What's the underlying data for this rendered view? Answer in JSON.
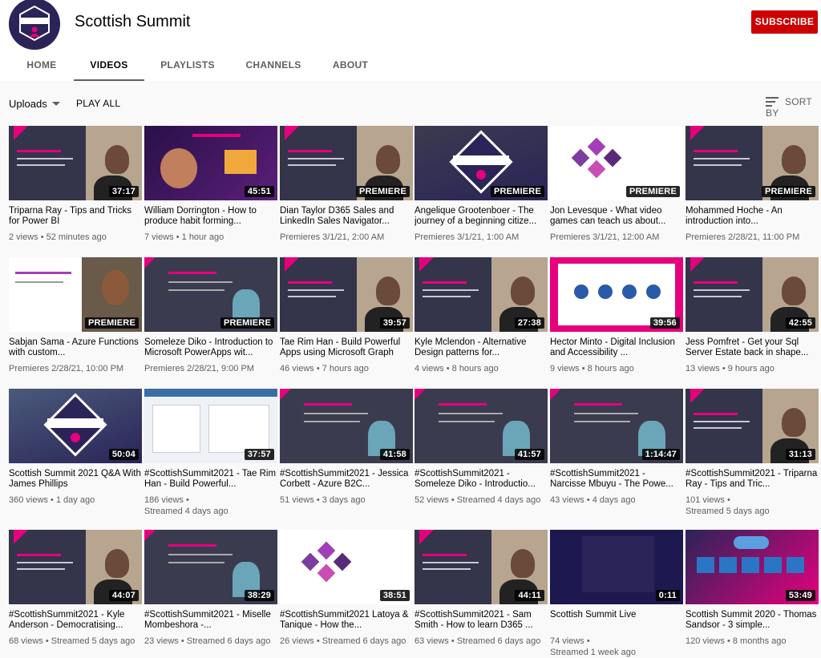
{
  "channel": {
    "name": "Scottish Summit",
    "subscribe_label": "SUBSCRIBE",
    "brand_color": "#2a2458",
    "accent_color": "#e6007e"
  },
  "tabs": [
    "HOME",
    "VIDEOS",
    "PLAYLISTS",
    "CHANNELS",
    "ABOUT"
  ],
  "active_tab": "VIDEOS",
  "toolbar": {
    "uploads_label": "Uploads",
    "play_all_label": "PLAY ALL",
    "sort_by_label": "SORT BY"
  },
  "videos": [
    {
      "title": "Triparna Ray - Tips and Tricks for Power BI",
      "meta1": "2 views • 52 minutes ago",
      "meta2": "",
      "badge": "37:17",
      "theme": "pinkpanel",
      "bg": "#3b3b4f"
    },
    {
      "title": "William Dorrington - How to produce habit forming...",
      "meta1": "7 views • 1 hour ago",
      "meta2": "",
      "badge": "45:51",
      "theme": "purple",
      "bg": "#3a1c5c"
    },
    {
      "title": "Dian Taylor D365 Sales and LinkedIn Sales Navigator...",
      "meta1": "Premieres 3/1/21, 2:00 AM",
      "meta2": "",
      "badge": "PREMIERE",
      "theme": "pinkpanel",
      "bg": "#3b3b4f"
    },
    {
      "title": "Angelique Grootenboer - The journey of a beginning citize...",
      "meta1": "Premieres 3/1/21, 1:00 AM",
      "meta2": "",
      "badge": "PREMIERE",
      "theme": "logo",
      "bg": "#3b3b4f"
    },
    {
      "title": "Jon Levesque - What video games can teach us about...",
      "meta1": "Premieres 3/1/21, 12:00 AM",
      "meta2": "",
      "badge": "PREMIERE",
      "theme": "white",
      "bg": "#ffffff"
    },
    {
      "title": "Mohammed Hoche - An introduction into...",
      "meta1": "Premieres 2/28/21, 11:00 PM",
      "meta2": "",
      "badge": "PREMIERE",
      "theme": "pinkpanel",
      "bg": "#3b3b4f"
    },
    {
      "title": "Sabjan Sama - Azure Functions with custom...",
      "meta1": "Premieres 2/28/21, 10:00 PM",
      "meta2": "",
      "badge": "PREMIERE",
      "theme": "whitepanel",
      "bg": "#f2f2f2"
    },
    {
      "title": "Someleze Diko - Introduction to Microsoft PowerApps wit...",
      "meta1": "Premieres 2/28/21, 9:00 PM",
      "meta2": "",
      "badge": "PREMIERE",
      "theme": "dark",
      "bg": "#3b3b4f"
    },
    {
      "title": "Tae Rim Han - Build Powerful Apps using Microsoft Graph",
      "meta1": "46 views • 7 hours ago",
      "meta2": "",
      "badge": "39:57",
      "theme": "pinkpanel",
      "bg": "#3b3b4f"
    },
    {
      "title": "Kyle Mclendon - Alternative Design patterns for...",
      "meta1": "4 views • 8 hours ago",
      "meta2": "",
      "badge": "27:38",
      "theme": "pinkpanel",
      "bg": "#3b3b4f"
    },
    {
      "title": "Hector Minto - Digital Inclusion and Accessibility ...",
      "meta1": "9 views • 8 hours ago",
      "meta2": "",
      "badge": "39:56",
      "theme": "pinkframe",
      "bg": "#e6007e"
    },
    {
      "title": "Jess Pomfret - Get your Sql Server Estate back in shape...",
      "meta1": "13 views • 9 hours ago",
      "meta2": "",
      "badge": "42:55",
      "theme": "pinkpanel",
      "bg": "#3b3b4f"
    },
    {
      "title": "Scottish Summit 2021 Q&A With James Phillips",
      "meta1": "360 views • 1 day ago",
      "meta2": "",
      "badge": "50:04",
      "theme": "logo",
      "bg": "#4a5a7a"
    },
    {
      "title": "#ScottishSummit2021 - Tae Rim Han - Build Powerful...",
      "meta1": "186 views •",
      "meta2": "Streamed 4 days ago",
      "badge": "37:57",
      "theme": "screen",
      "bg": "#eef1f5"
    },
    {
      "title": "#ScottishSummit2021 - Jessica Corbett - Azure B2C...",
      "meta1": "51 views • 3 days ago",
      "meta2": "",
      "badge": "41:58",
      "theme": "dark",
      "bg": "#3b3b4f"
    },
    {
      "title": "#ScottishSummit2021 - Someleze Diko - Introductio...",
      "meta1": "52 views • Streamed 4 days ago",
      "meta2": "",
      "badge": "41:57",
      "theme": "dark",
      "bg": "#3b3b4f"
    },
    {
      "title": "#ScottishSummit2021 - Narcisse Mbuyu - The Powe...",
      "meta1": "43 views • 4 days ago",
      "meta2": "",
      "badge": "1:14:47",
      "theme": "dark",
      "bg": "#33334a"
    },
    {
      "title": "#ScottishSummit2021 - Triparna Ray - Tips and Tric...",
      "meta1": "101 views •",
      "meta2": "Streamed 5 days ago",
      "badge": "31:13",
      "theme": "pinkpanel",
      "bg": "#3b3b4f"
    },
    {
      "title": "#ScottishSummit2021 - Kyle Anderson - Democratising...",
      "meta1": "68 views • Streamed 5 days ago",
      "meta2": "",
      "badge": "44:07",
      "theme": "pinkpanel",
      "bg": "#ffffff"
    },
    {
      "title": "#ScottishSummit2021 - Miselle Mombeshora -...",
      "meta1": "23 views • Streamed 6 days ago",
      "meta2": "",
      "badge": "38:29",
      "theme": "dark",
      "bg": "#3b3b4f"
    },
    {
      "title": "#ScottishSummit2021 Latoya & Tanique - How the...",
      "meta1": "26 views • Streamed 6 days ago",
      "meta2": "",
      "badge": "38:51",
      "theme": "white",
      "bg": "#ffffff"
    },
    {
      "title": "#ScottishSummit2021 - Sam Smith - How to learn D365 ...",
      "meta1": "63 views • Streamed 6 days ago",
      "meta2": "",
      "badge": "44:11",
      "theme": "pinkpanel",
      "bg": "#2b2b3a"
    },
    {
      "title": "Scottish Summit Live",
      "meta1": "74 views •",
      "meta2": "Streamed 1 week ago",
      "badge": "0:11",
      "theme": "live",
      "bg": "#1e1850"
    },
    {
      "title": "Scottish Summit 2020 - Thomas Sandsor - 3 simple...",
      "meta1": "120 views • 8 months ago",
      "meta2": "",
      "badge": "53:49",
      "theme": "diagram",
      "bg": "#2a2458"
    }
  ]
}
